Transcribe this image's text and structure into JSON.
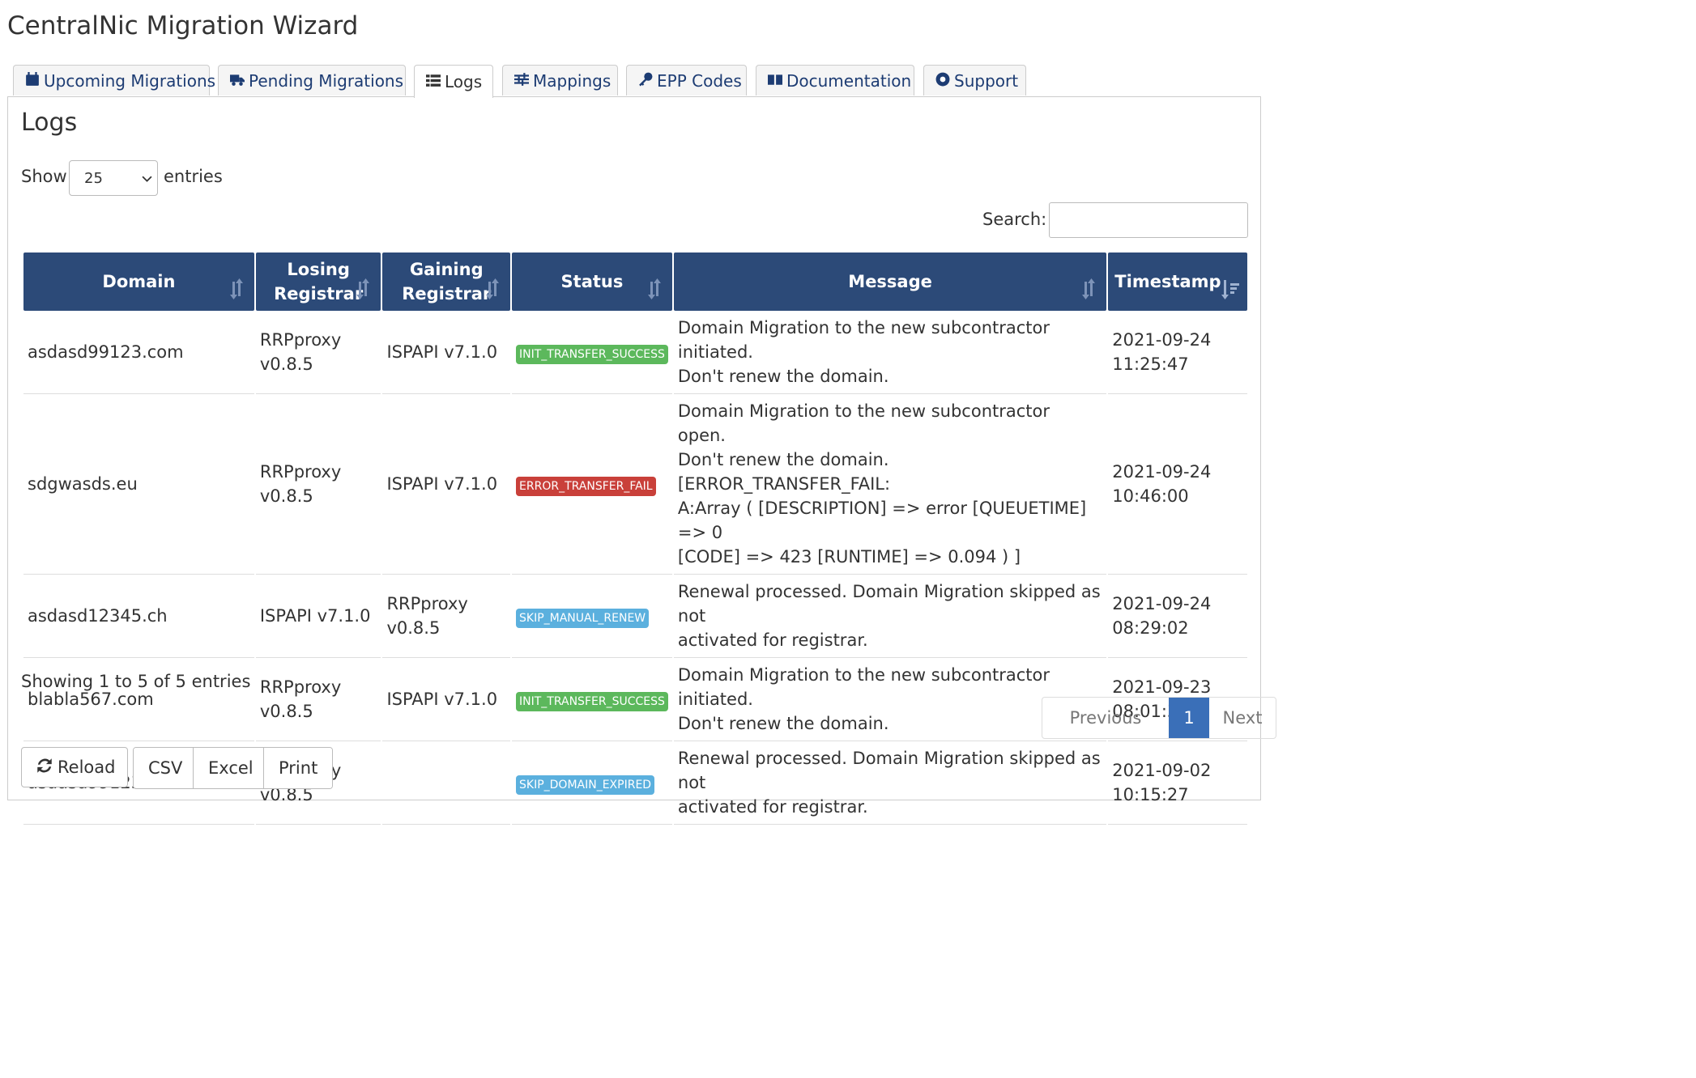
{
  "app": {
    "title": "CentralNic Migration Wizard"
  },
  "tabs": [
    {
      "label": "Upcoming Migrations",
      "icon": "calendar-icon"
    },
    {
      "label": "Pending Migrations",
      "icon": "truck-icon"
    },
    {
      "label": "Logs",
      "icon": "list-icon"
    },
    {
      "label": "Mappings",
      "icon": "sliders-icon"
    },
    {
      "label": "EPP Codes",
      "icon": "key-icon"
    },
    {
      "label": "Documentation",
      "icon": "book-icon"
    },
    {
      "label": "Support",
      "icon": "lifebuoy-icon"
    }
  ],
  "section": {
    "heading": "Logs"
  },
  "length_menu": {
    "show_label": "Show",
    "value": "25",
    "entries_label": "entries"
  },
  "search": {
    "label": "Search:",
    "value": ""
  },
  "table": {
    "columns": [
      "Domain",
      "Losing Registrar",
      "Gaining Registrar",
      "Status",
      "Message",
      "Timestamp"
    ],
    "column_lines": [
      [
        "Domain"
      ],
      [
        "Losing",
        "Registrar"
      ],
      [
        "Gaining",
        "Registrar"
      ],
      [
        "Status"
      ],
      [
        "Message"
      ],
      [
        "Timestamp"
      ]
    ],
    "rows": [
      {
        "domain": "asdasd99123.com",
        "losing": [
          "RRPproxy",
          "v0.8.5"
        ],
        "gaining": [
          "ISPAPI v7.1.0"
        ],
        "status": "INIT_TRANSFER_SUCCESS",
        "status_color": "#5cb85c",
        "message": [
          "Domain Migration to the new subcontractor initiated.",
          "Don't renew the domain."
        ],
        "timestamp": [
          "2021-09-24",
          "11:25:47"
        ]
      },
      {
        "domain": "sdgwasds.eu",
        "losing": [
          "RRPproxy",
          "v0.8.5"
        ],
        "gaining": [
          "ISPAPI v7.1.0"
        ],
        "status": "ERROR_TRANSFER_FAIL",
        "status_color": "#c9403a",
        "message": [
          "Domain Migration to the new subcontractor open.",
          "Don't renew the domain. [ERROR_TRANSFER_FAIL:",
          "A:Array ( [DESCRIPTION] => error [QUEUETIME] => 0",
          "[CODE] => 423 [RUNTIME] => 0.094 ) ]"
        ],
        "timestamp": [
          "2021-09-24",
          "10:46:00"
        ]
      },
      {
        "domain": "asdasd12345.ch",
        "losing": [
          "ISPAPI v7.1.0"
        ],
        "gaining": [
          "RRPproxy",
          "v0.8.5"
        ],
        "status": "SKIP_MANUAL_RENEW",
        "status_color": "#5bb0de",
        "message": [
          "Renewal processed. Domain Migration skipped as not",
          "activated for registrar."
        ],
        "timestamp": [
          "2021-09-24",
          "08:29:02"
        ]
      },
      {
        "domain": "blabla567.com",
        "losing": [
          "RRPproxy",
          "v0.8.5"
        ],
        "gaining": [
          "ISPAPI v7.1.0"
        ],
        "status": "INIT_TRANSFER_SUCCESS",
        "status_color": "#5cb85c",
        "message": [
          "Domain Migration to the new subcontractor initiated.",
          "Don't renew the domain."
        ],
        "timestamp": [
          "2021-09-23",
          "08:01:35"
        ]
      },
      {
        "domain": "asdasd99123.com",
        "losing": [
          "RRPproxy",
          "v0.8.5"
        ],
        "gaining": [],
        "status": "SKIP_DOMAIN_EXPIRED",
        "status_color": "#5bb0de",
        "message": [
          "Renewal processed. Domain Migration skipped as not",
          "activated for registrar."
        ],
        "timestamp": [
          "2021-09-02",
          "10:15:27"
        ]
      }
    ]
  },
  "info": "Showing 1 to 5 of 5 entries",
  "pagination": {
    "previous": "Previous",
    "current": "1",
    "next": "Next"
  },
  "buttons": {
    "reload": "Reload",
    "csv": "CSV",
    "excel": "Excel",
    "print": "Print"
  }
}
